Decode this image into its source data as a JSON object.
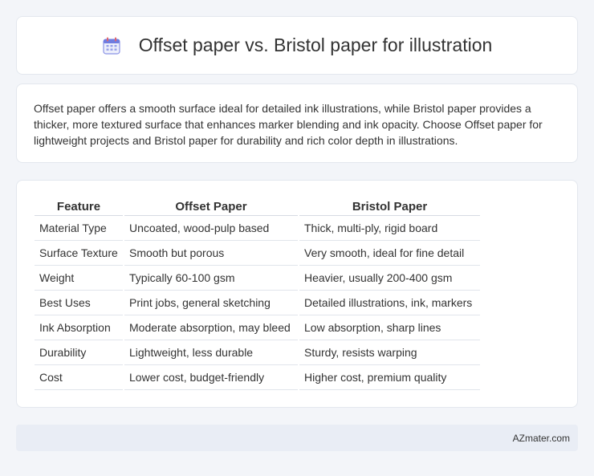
{
  "header": {
    "title": "Offset paper vs. Bristol paper for illustration",
    "icon": "calendar-icon"
  },
  "summary": {
    "text": "Offset paper offers a smooth surface ideal for detailed ink illustrations, while Bristol paper provides a thicker, more textured surface that enhances marker blending and ink opacity. Choose Offset paper for lightweight projects and Bristol paper for durability and rich color depth in illustrations."
  },
  "table": {
    "headers": [
      "Feature",
      "Offset Paper",
      "Bristol Paper"
    ],
    "rows": [
      [
        "Material Type",
        "Uncoated, wood-pulp based",
        "Thick, multi-ply, rigid board"
      ],
      [
        "Surface Texture",
        "Smooth but porous",
        "Very smooth, ideal for fine detail"
      ],
      [
        "Weight",
        "Typically 60-100 gsm",
        "Heavier, usually 200-400 gsm"
      ],
      [
        "Best Uses",
        "Print jobs, general sketching",
        "Detailed illustrations, ink, markers"
      ],
      [
        "Ink Absorption",
        "Moderate absorption, may bleed",
        "Low absorption, sharp lines"
      ],
      [
        "Durability",
        "Lightweight, less durable",
        "Sturdy, resists warping"
      ],
      [
        "Cost",
        "Lower cost, budget-friendly",
        "Higher cost, premium quality"
      ]
    ]
  },
  "footer": {
    "brand": "AZmater.com"
  }
}
